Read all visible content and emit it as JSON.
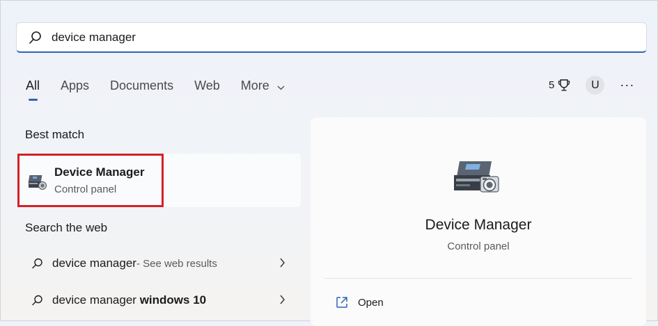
{
  "search": {
    "value": "device manager",
    "icon": "search-icon"
  },
  "tabs": [
    {
      "label": "All",
      "active": true
    },
    {
      "label": "Apps"
    },
    {
      "label": "Documents"
    },
    {
      "label": "Web"
    },
    {
      "label": "More"
    }
  ],
  "header_right": {
    "points": "5",
    "avatar_initial": "U",
    "more": "···"
  },
  "best_match": {
    "heading": "Best match",
    "title": "Device Manager",
    "subtitle": "Control panel"
  },
  "web": {
    "heading": "Search the web",
    "rows": [
      {
        "text": "device manager",
        "hint": " - See web results",
        "bold_suffix": ""
      },
      {
        "text": "device manager ",
        "hint": "",
        "bold_suffix": "windows 10"
      }
    ]
  },
  "detail": {
    "title": "Device Manager",
    "subtitle": "Control panel",
    "actions": [
      {
        "label": "Open",
        "icon": "open-external-icon"
      }
    ]
  },
  "colors": {
    "accent": "#2f63b6",
    "highlight": "#d42027"
  }
}
